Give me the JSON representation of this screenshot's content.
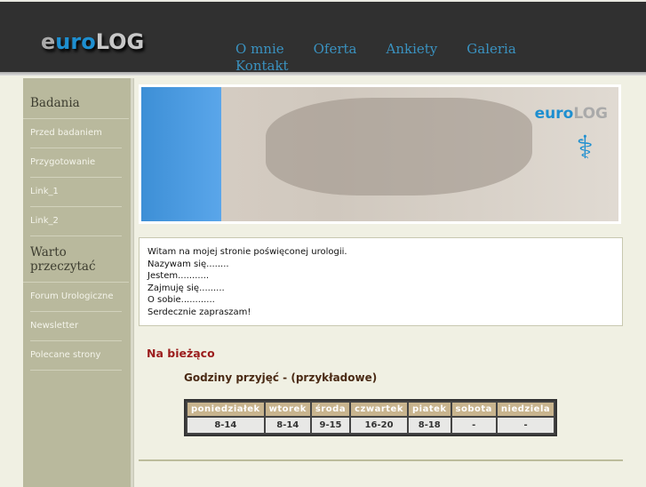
{
  "header": {
    "logo": "euroLOG",
    "nav": [
      "O mnie",
      "Oferta",
      "Ankiety",
      "Galeria",
      "Kontakt"
    ]
  },
  "sidebar": {
    "section1": "Badania",
    "items1": [
      "Przed badaniem",
      "Przygotowanie",
      "Link_1",
      "Link_2"
    ],
    "section2": "Warto przeczytać",
    "items2": [
      "Forum Urologiczne",
      "Newsletter",
      "Polecane strony"
    ]
  },
  "banner": {
    "logo": "euroLOG"
  },
  "intro": [
    "Witam na mojej stronie poświęconej urologii.",
    "Nazywam się........",
    "Jestem...........",
    "Zajmuję się.........",
    "O sobie............",
    "Serdecznie zapraszam!"
  ],
  "news": {
    "title": "Na bieżąco",
    "subtitle": "Godziny przyjęć - (przykładowe)"
  },
  "table": {
    "headers": [
      "poniedziałek",
      "wtorek",
      "środa",
      "czwartek",
      "piatek",
      "sobota",
      "niedziela"
    ],
    "values": [
      "8-14",
      "8-14",
      "9-15",
      "16-20",
      "8-18",
      "-",
      "-"
    ]
  }
}
